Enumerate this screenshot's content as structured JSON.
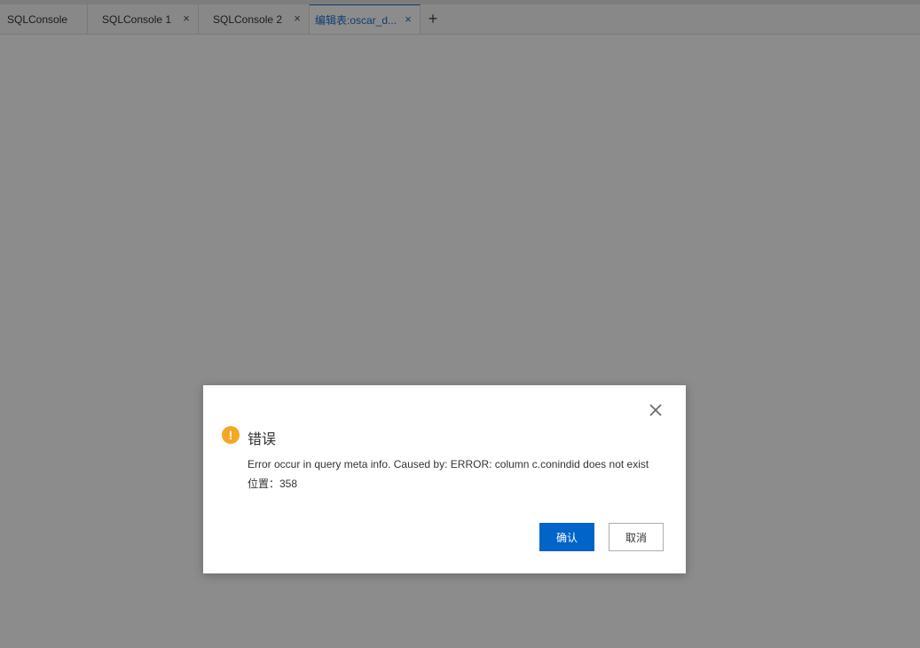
{
  "tabs": [
    {
      "label": "SQLConsole",
      "closable": false,
      "active": false
    },
    {
      "label": "SQLConsole 1",
      "closable": true,
      "active": false
    },
    {
      "label": "SQLConsole 2",
      "closable": true,
      "active": false
    },
    {
      "label": "编辑表:oscar_d...",
      "closable": true,
      "active": true
    }
  ],
  "tab_close_glyph": "×",
  "add_tab_glyph": "+",
  "dialog": {
    "title": "错误",
    "message": "Error occur in query meta info. Caused by: ERROR: column c.conindid does not exist",
    "position_line": "位置：358",
    "ok_label": "确认",
    "cancel_label": "取消",
    "icon": "warning-icon",
    "accent_color": "#0064c8",
    "warning_color": "#f5a623"
  }
}
